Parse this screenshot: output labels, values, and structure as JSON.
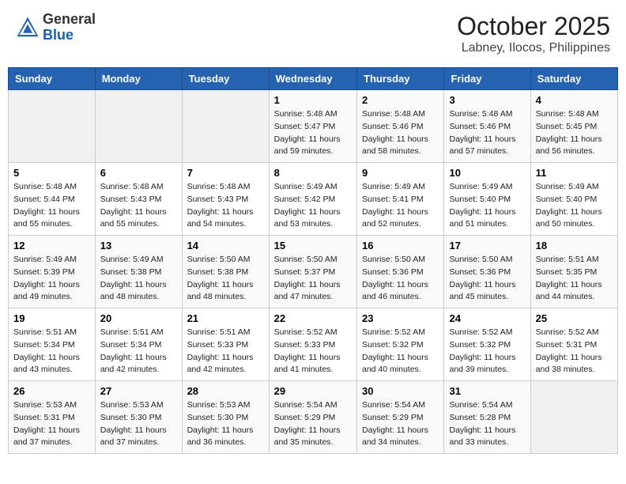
{
  "header": {
    "logo_general": "General",
    "logo_blue": "Blue",
    "month": "October 2025",
    "location": "Labney, Ilocos, Philippines"
  },
  "weekdays": [
    "Sunday",
    "Monday",
    "Tuesday",
    "Wednesday",
    "Thursday",
    "Friday",
    "Saturday"
  ],
  "weeks": [
    [
      {
        "day": "",
        "sunrise": "",
        "sunset": "",
        "daylight": ""
      },
      {
        "day": "",
        "sunrise": "",
        "sunset": "",
        "daylight": ""
      },
      {
        "day": "",
        "sunrise": "",
        "sunset": "",
        "daylight": ""
      },
      {
        "day": "1",
        "sunrise": "Sunrise: 5:48 AM",
        "sunset": "Sunset: 5:47 PM",
        "daylight": "Daylight: 11 hours and 59 minutes."
      },
      {
        "day": "2",
        "sunrise": "Sunrise: 5:48 AM",
        "sunset": "Sunset: 5:46 PM",
        "daylight": "Daylight: 11 hours and 58 minutes."
      },
      {
        "day": "3",
        "sunrise": "Sunrise: 5:48 AM",
        "sunset": "Sunset: 5:46 PM",
        "daylight": "Daylight: 11 hours and 57 minutes."
      },
      {
        "day": "4",
        "sunrise": "Sunrise: 5:48 AM",
        "sunset": "Sunset: 5:45 PM",
        "daylight": "Daylight: 11 hours and 56 minutes."
      }
    ],
    [
      {
        "day": "5",
        "sunrise": "Sunrise: 5:48 AM",
        "sunset": "Sunset: 5:44 PM",
        "daylight": "Daylight: 11 hours and 55 minutes."
      },
      {
        "day": "6",
        "sunrise": "Sunrise: 5:48 AM",
        "sunset": "Sunset: 5:43 PM",
        "daylight": "Daylight: 11 hours and 55 minutes."
      },
      {
        "day": "7",
        "sunrise": "Sunrise: 5:48 AM",
        "sunset": "Sunset: 5:43 PM",
        "daylight": "Daylight: 11 hours and 54 minutes."
      },
      {
        "day": "8",
        "sunrise": "Sunrise: 5:49 AM",
        "sunset": "Sunset: 5:42 PM",
        "daylight": "Daylight: 11 hours and 53 minutes."
      },
      {
        "day": "9",
        "sunrise": "Sunrise: 5:49 AM",
        "sunset": "Sunset: 5:41 PM",
        "daylight": "Daylight: 11 hours and 52 minutes."
      },
      {
        "day": "10",
        "sunrise": "Sunrise: 5:49 AM",
        "sunset": "Sunset: 5:40 PM",
        "daylight": "Daylight: 11 hours and 51 minutes."
      },
      {
        "day": "11",
        "sunrise": "Sunrise: 5:49 AM",
        "sunset": "Sunset: 5:40 PM",
        "daylight": "Daylight: 11 hours and 50 minutes."
      }
    ],
    [
      {
        "day": "12",
        "sunrise": "Sunrise: 5:49 AM",
        "sunset": "Sunset: 5:39 PM",
        "daylight": "Daylight: 11 hours and 49 minutes."
      },
      {
        "day": "13",
        "sunrise": "Sunrise: 5:49 AM",
        "sunset": "Sunset: 5:38 PM",
        "daylight": "Daylight: 11 hours and 48 minutes."
      },
      {
        "day": "14",
        "sunrise": "Sunrise: 5:50 AM",
        "sunset": "Sunset: 5:38 PM",
        "daylight": "Daylight: 11 hours and 48 minutes."
      },
      {
        "day": "15",
        "sunrise": "Sunrise: 5:50 AM",
        "sunset": "Sunset: 5:37 PM",
        "daylight": "Daylight: 11 hours and 47 minutes."
      },
      {
        "day": "16",
        "sunrise": "Sunrise: 5:50 AM",
        "sunset": "Sunset: 5:36 PM",
        "daylight": "Daylight: 11 hours and 46 minutes."
      },
      {
        "day": "17",
        "sunrise": "Sunrise: 5:50 AM",
        "sunset": "Sunset: 5:36 PM",
        "daylight": "Daylight: 11 hours and 45 minutes."
      },
      {
        "day": "18",
        "sunrise": "Sunrise: 5:51 AM",
        "sunset": "Sunset: 5:35 PM",
        "daylight": "Daylight: 11 hours and 44 minutes."
      }
    ],
    [
      {
        "day": "19",
        "sunrise": "Sunrise: 5:51 AM",
        "sunset": "Sunset: 5:34 PM",
        "daylight": "Daylight: 11 hours and 43 minutes."
      },
      {
        "day": "20",
        "sunrise": "Sunrise: 5:51 AM",
        "sunset": "Sunset: 5:34 PM",
        "daylight": "Daylight: 11 hours and 42 minutes."
      },
      {
        "day": "21",
        "sunrise": "Sunrise: 5:51 AM",
        "sunset": "Sunset: 5:33 PM",
        "daylight": "Daylight: 11 hours and 42 minutes."
      },
      {
        "day": "22",
        "sunrise": "Sunrise: 5:52 AM",
        "sunset": "Sunset: 5:33 PM",
        "daylight": "Daylight: 11 hours and 41 minutes."
      },
      {
        "day": "23",
        "sunrise": "Sunrise: 5:52 AM",
        "sunset": "Sunset: 5:32 PM",
        "daylight": "Daylight: 11 hours and 40 minutes."
      },
      {
        "day": "24",
        "sunrise": "Sunrise: 5:52 AM",
        "sunset": "Sunset: 5:32 PM",
        "daylight": "Daylight: 11 hours and 39 minutes."
      },
      {
        "day": "25",
        "sunrise": "Sunrise: 5:52 AM",
        "sunset": "Sunset: 5:31 PM",
        "daylight": "Daylight: 11 hours and 38 minutes."
      }
    ],
    [
      {
        "day": "26",
        "sunrise": "Sunrise: 5:53 AM",
        "sunset": "Sunset: 5:31 PM",
        "daylight": "Daylight: 11 hours and 37 minutes."
      },
      {
        "day": "27",
        "sunrise": "Sunrise: 5:53 AM",
        "sunset": "Sunset: 5:30 PM",
        "daylight": "Daylight: 11 hours and 37 minutes."
      },
      {
        "day": "28",
        "sunrise": "Sunrise: 5:53 AM",
        "sunset": "Sunset: 5:30 PM",
        "daylight": "Daylight: 11 hours and 36 minutes."
      },
      {
        "day": "29",
        "sunrise": "Sunrise: 5:54 AM",
        "sunset": "Sunset: 5:29 PM",
        "daylight": "Daylight: 11 hours and 35 minutes."
      },
      {
        "day": "30",
        "sunrise": "Sunrise: 5:54 AM",
        "sunset": "Sunset: 5:29 PM",
        "daylight": "Daylight: 11 hours and 34 minutes."
      },
      {
        "day": "31",
        "sunrise": "Sunrise: 5:54 AM",
        "sunset": "Sunset: 5:28 PM",
        "daylight": "Daylight: 11 hours and 33 minutes."
      },
      {
        "day": "",
        "sunrise": "",
        "sunset": "",
        "daylight": ""
      }
    ]
  ]
}
